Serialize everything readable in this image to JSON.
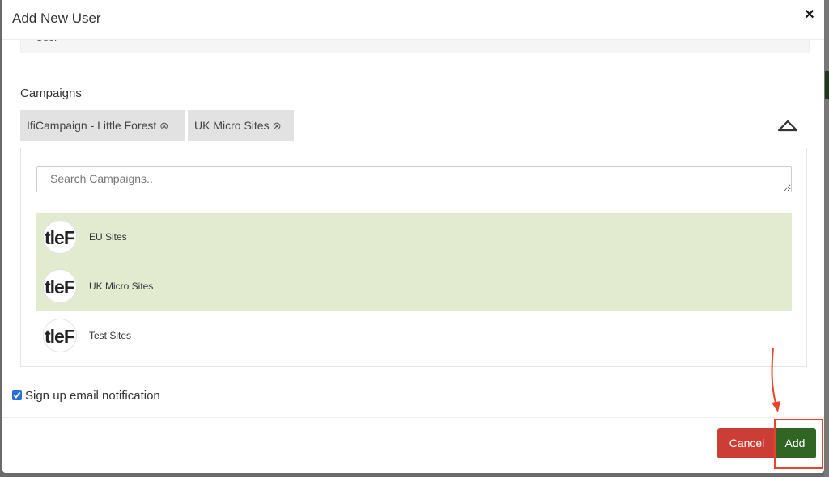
{
  "modal": {
    "title": "Add New User",
    "close_icon": "close-icon"
  },
  "role_select": {
    "value": "User",
    "icon": "caret-down-icon"
  },
  "campaigns": {
    "label": "Campaigns",
    "selected_tags": [
      {
        "label": "IfiCampaign - Little Forest",
        "remove_icon": "⊗"
      },
      {
        "label": "UK Micro Sites",
        "remove_icon": "⊗"
      }
    ],
    "collapse_icon": "chevron-up-icon",
    "search": {
      "placeholder": "Search Campaigns..",
      "value": ""
    },
    "options": [
      {
        "avatar_text": "tleF",
        "label": "EU Sites",
        "selected": true
      },
      {
        "avatar_text": "tleF",
        "label": "UK Micro Sites",
        "selected": true
      },
      {
        "avatar_text": "tleF",
        "label": "Test Sites",
        "selected": false
      }
    ],
    "selected_color": "#e2ebd0"
  },
  "notification": {
    "label": "Sign up email notification",
    "checked": true
  },
  "footer": {
    "cancel_label": "Cancel",
    "add_label": "Add",
    "cancel_color": "#cc3d35",
    "add_color": "#316523"
  },
  "annotation": {
    "color": "#e8432d",
    "target": "add-button"
  }
}
